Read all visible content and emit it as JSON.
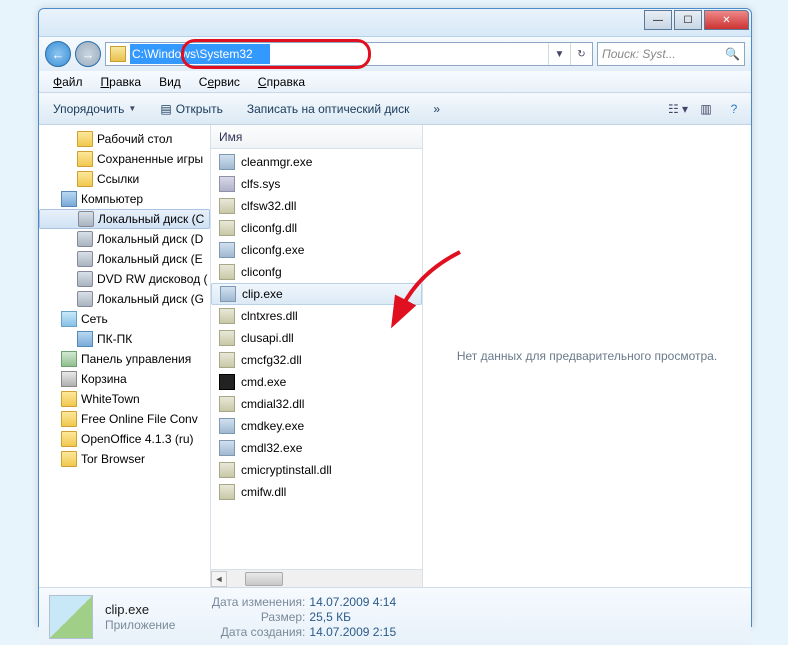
{
  "address": {
    "path": "C:\\Windows\\System32"
  },
  "search": {
    "placeholder": "Поиск: Syst..."
  },
  "menu": {
    "file": "Файл",
    "edit": "Правка",
    "view": "Вид",
    "tools": "Сервис",
    "help": "Справка"
  },
  "toolbar": {
    "organize": "Упорядочить",
    "open": "Открыть",
    "burn": "Записать на оптический диск"
  },
  "columns": {
    "name": "Имя"
  },
  "tree": [
    {
      "label": "Рабочий стол",
      "icon": "folder",
      "ind": 1
    },
    {
      "label": "Сохраненные игры",
      "icon": "folder",
      "ind": 1
    },
    {
      "label": "Ссылки",
      "icon": "folder",
      "ind": 1
    },
    {
      "label": "Компьютер",
      "icon": "comp",
      "ind": 0
    },
    {
      "label": "Локальный диск (C",
      "icon": "drive",
      "ind": 1,
      "sel": true
    },
    {
      "label": "Локальный диск (D",
      "icon": "drive",
      "ind": 1
    },
    {
      "label": "Локальный диск (E",
      "icon": "drive",
      "ind": 1
    },
    {
      "label": "DVD RW дисковод (",
      "icon": "drive",
      "ind": 1
    },
    {
      "label": "Локальный диск (G",
      "icon": "drive",
      "ind": 1
    },
    {
      "label": "Сеть",
      "icon": "net",
      "ind": 0
    },
    {
      "label": "ПК-ПК",
      "icon": "comp",
      "ind": 1
    },
    {
      "label": "Панель управления",
      "icon": "cp",
      "ind": 0
    },
    {
      "label": "Корзина",
      "icon": "bin",
      "ind": 0
    },
    {
      "label": "WhiteTown",
      "icon": "folder",
      "ind": 0
    },
    {
      "label": "Free Online File Conv",
      "icon": "folder",
      "ind": 0
    },
    {
      "label": "OpenOffice 4.1.3 (ru)",
      "icon": "folder",
      "ind": 0
    },
    {
      "label": "Tor Browser",
      "icon": "folder",
      "ind": 0
    }
  ],
  "files": [
    {
      "name": "cleanmgr.exe",
      "icon": "exe"
    },
    {
      "name": "clfs.sys",
      "icon": "sys"
    },
    {
      "name": "clfsw32.dll",
      "icon": "dll"
    },
    {
      "name": "cliconfg.dll",
      "icon": "dll"
    },
    {
      "name": "cliconfg.exe",
      "icon": "exe"
    },
    {
      "name": "cliconfg",
      "icon": "dll"
    },
    {
      "name": "clip.exe",
      "icon": "exe",
      "sel": true
    },
    {
      "name": "clntxres.dll",
      "icon": "dll"
    },
    {
      "name": "clusapi.dll",
      "icon": "dll"
    },
    {
      "name": "cmcfg32.dll",
      "icon": "dll"
    },
    {
      "name": "cmd.exe",
      "icon": "cmd"
    },
    {
      "name": "cmdial32.dll",
      "icon": "dll"
    },
    {
      "name": "cmdkey.exe",
      "icon": "exe"
    },
    {
      "name": "cmdl32.exe",
      "icon": "exe"
    },
    {
      "name": "cmicryptinstall.dll",
      "icon": "dll"
    },
    {
      "name": "cmifw.dll",
      "icon": "dll"
    }
  ],
  "preview": {
    "empty": "Нет данных для предварительного просмотра."
  },
  "details": {
    "name": "clip.exe",
    "type": "Приложение",
    "props": [
      {
        "k": "Дата изменения:",
        "v": "14.07.2009 4:14"
      },
      {
        "k": "Размер:",
        "v": "25,5 КБ"
      },
      {
        "k": "Дата создания:",
        "v": "14.07.2009 2:15"
      }
    ]
  }
}
